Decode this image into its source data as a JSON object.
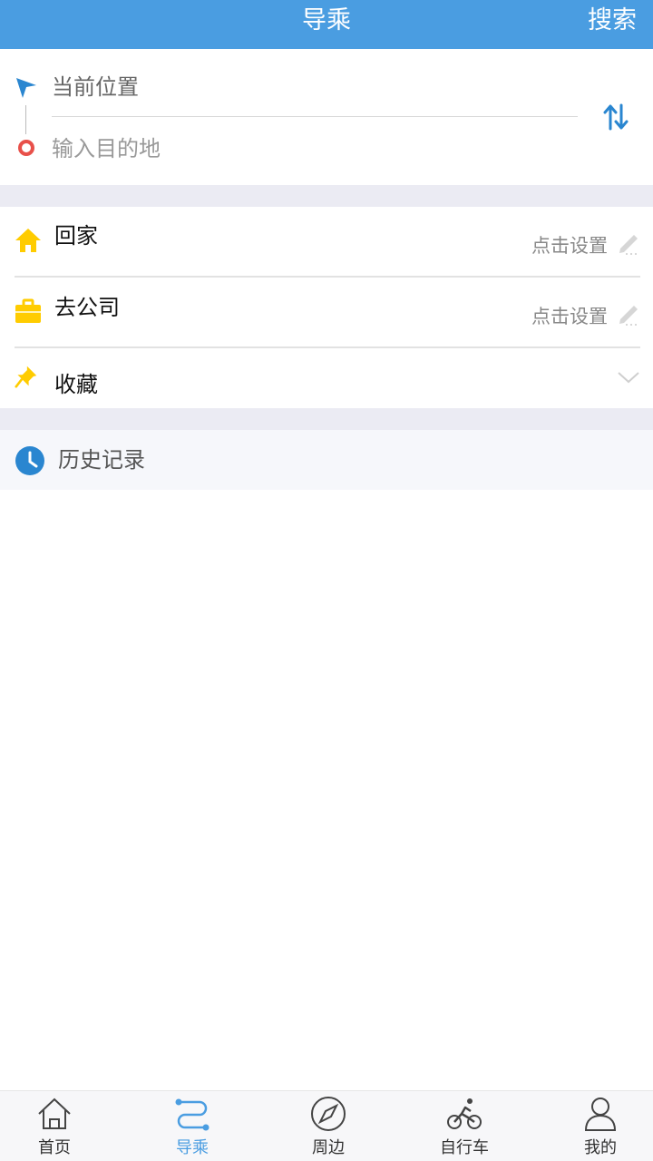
{
  "header": {
    "title": "导乘",
    "search_label": "搜索"
  },
  "route": {
    "from_label": "当前位置",
    "to_placeholder": "输入目的地",
    "icons": {
      "start": "navigation-arrow-icon",
      "end": "destination-ring-icon",
      "swap": "swap-vertical-icon"
    }
  },
  "favorites": {
    "home_label": "回家",
    "home_hint": "点击设置",
    "company_label": "去公司",
    "company_hint": "点击设置",
    "collect_label": "收藏"
  },
  "history": {
    "label": "历史记录"
  },
  "tabbar": {
    "items": [
      {
        "label": "首页",
        "icon": "home-icon"
      },
      {
        "label": "导乘",
        "icon": "route-icon"
      },
      {
        "label": "周边",
        "icon": "compass-icon"
      },
      {
        "label": "自行车",
        "icon": "bicycle-icon"
      },
      {
        "label": "我的",
        "icon": "user-icon"
      }
    ],
    "active_index": 1
  },
  "colors": {
    "accent": "#4a9de1",
    "home_icon": "#ffcc00",
    "destination": "#e8504a",
    "section_gap": "#ebebf3"
  }
}
